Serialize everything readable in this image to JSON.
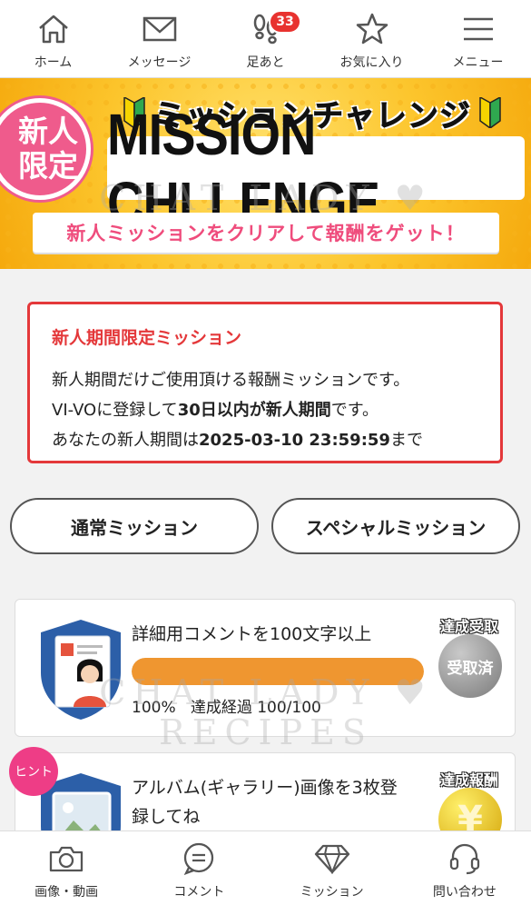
{
  "top_nav": {
    "items": [
      {
        "label": "ホーム",
        "icon": "home-icon"
      },
      {
        "label": "メッセージ",
        "icon": "envelope-icon"
      },
      {
        "label": "足あと",
        "icon": "footprints-icon",
        "badge": "33"
      },
      {
        "label": "お気に入り",
        "icon": "star-icon"
      },
      {
        "label": "メニュー",
        "icon": "menu-icon"
      }
    ]
  },
  "banner": {
    "seal_line1": "新人",
    "seal_line2": "限定",
    "title_jp": "ミッションチャレンジ",
    "title_en": "MISSION CHLLENGE",
    "subtitle": "新人ミッションをクリアして報酬をゲット！",
    "watermark": "CHAT LADY ♥ RECIPES"
  },
  "notice": {
    "title": "新人期間限定ミッション",
    "line1": "新人期間だけご使用頂ける報酬ミッションです。",
    "line2_pre": "VI-VOに登録して",
    "line2_bold": "30日以内が新人期間",
    "line2_post": "です。",
    "line3_pre": "あなたの新人期間は",
    "line3_bold": "2025-03-10 23:59:59",
    "line3_post": "まで"
  },
  "tabs": {
    "normal": "通常ミッション",
    "special": "スペシャルミッション"
  },
  "missions": [
    {
      "title": "詳細用コメントを100文字以上",
      "progress_percent": 100,
      "percent_label": "100%",
      "status_label": "達成経過 100/100",
      "reward_label": "達成受取",
      "reward_button": "受取済"
    },
    {
      "title_line1": "アルバム(ギャラリー)画像を3枚登",
      "title_line2": "録してね",
      "reward_label": "達成報酬",
      "reward_coin": "¥",
      "hint": "ヒント"
    }
  ],
  "watermark": "CHAT LADY ♥ RECIPES",
  "bottom_nav": {
    "items": [
      {
        "label": "画像・動画",
        "icon": "camera-icon"
      },
      {
        "label": "コメント",
        "icon": "comment-icon"
      },
      {
        "label": "ミッション",
        "icon": "diamond-icon"
      },
      {
        "label": "問い合わせ",
        "icon": "headset-icon"
      }
    ]
  },
  "colors": {
    "accent_red": "#e4383a",
    "pink": "#ef4c7c",
    "progress_orange": "#ef9630",
    "banner_yellow": "#fcc52c"
  }
}
